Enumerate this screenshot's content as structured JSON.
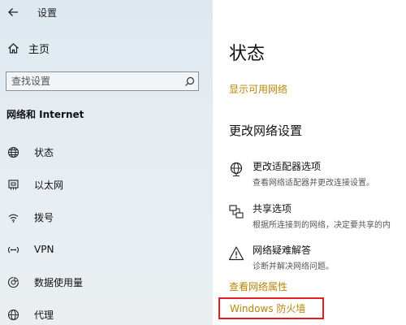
{
  "window": {
    "title": "设置"
  },
  "sidebar": {
    "home_label": "主页",
    "search_placeholder": "查找设置",
    "section_title": "网络和 Internet",
    "items": [
      {
        "label": "状态",
        "icon": "globe-icon"
      },
      {
        "label": "以太网",
        "icon": "ethernet-icon"
      },
      {
        "label": "拨号",
        "icon": "dialup-icon"
      },
      {
        "label": "VPN",
        "icon": "vpn-icon"
      },
      {
        "label": "数据使用量",
        "icon": "data-usage-icon"
      },
      {
        "label": "代理",
        "icon": "proxy-globe-icon"
      }
    ]
  },
  "main": {
    "title": "状态",
    "show_networks_link": "显示可用网络",
    "change_settings_header": "更改网络设置",
    "options": [
      {
        "title": "更改适配器选项",
        "desc": "查看网络适配器并更改连接设置。",
        "icon": "adapter-globe-icon"
      },
      {
        "title": "共享选项",
        "desc": "根据所连接到的网络，决定要共享的内",
        "icon": "sharing-icon"
      },
      {
        "title": "网络疑难解答",
        "desc": "诊断并解决网络问题。",
        "icon": "warning-icon"
      }
    ],
    "view_properties_link": "查看网络属性",
    "firewall_link": "Windows 防火墙"
  },
  "colors": {
    "link": "#b8860b",
    "highlight_border": "#e02020"
  }
}
